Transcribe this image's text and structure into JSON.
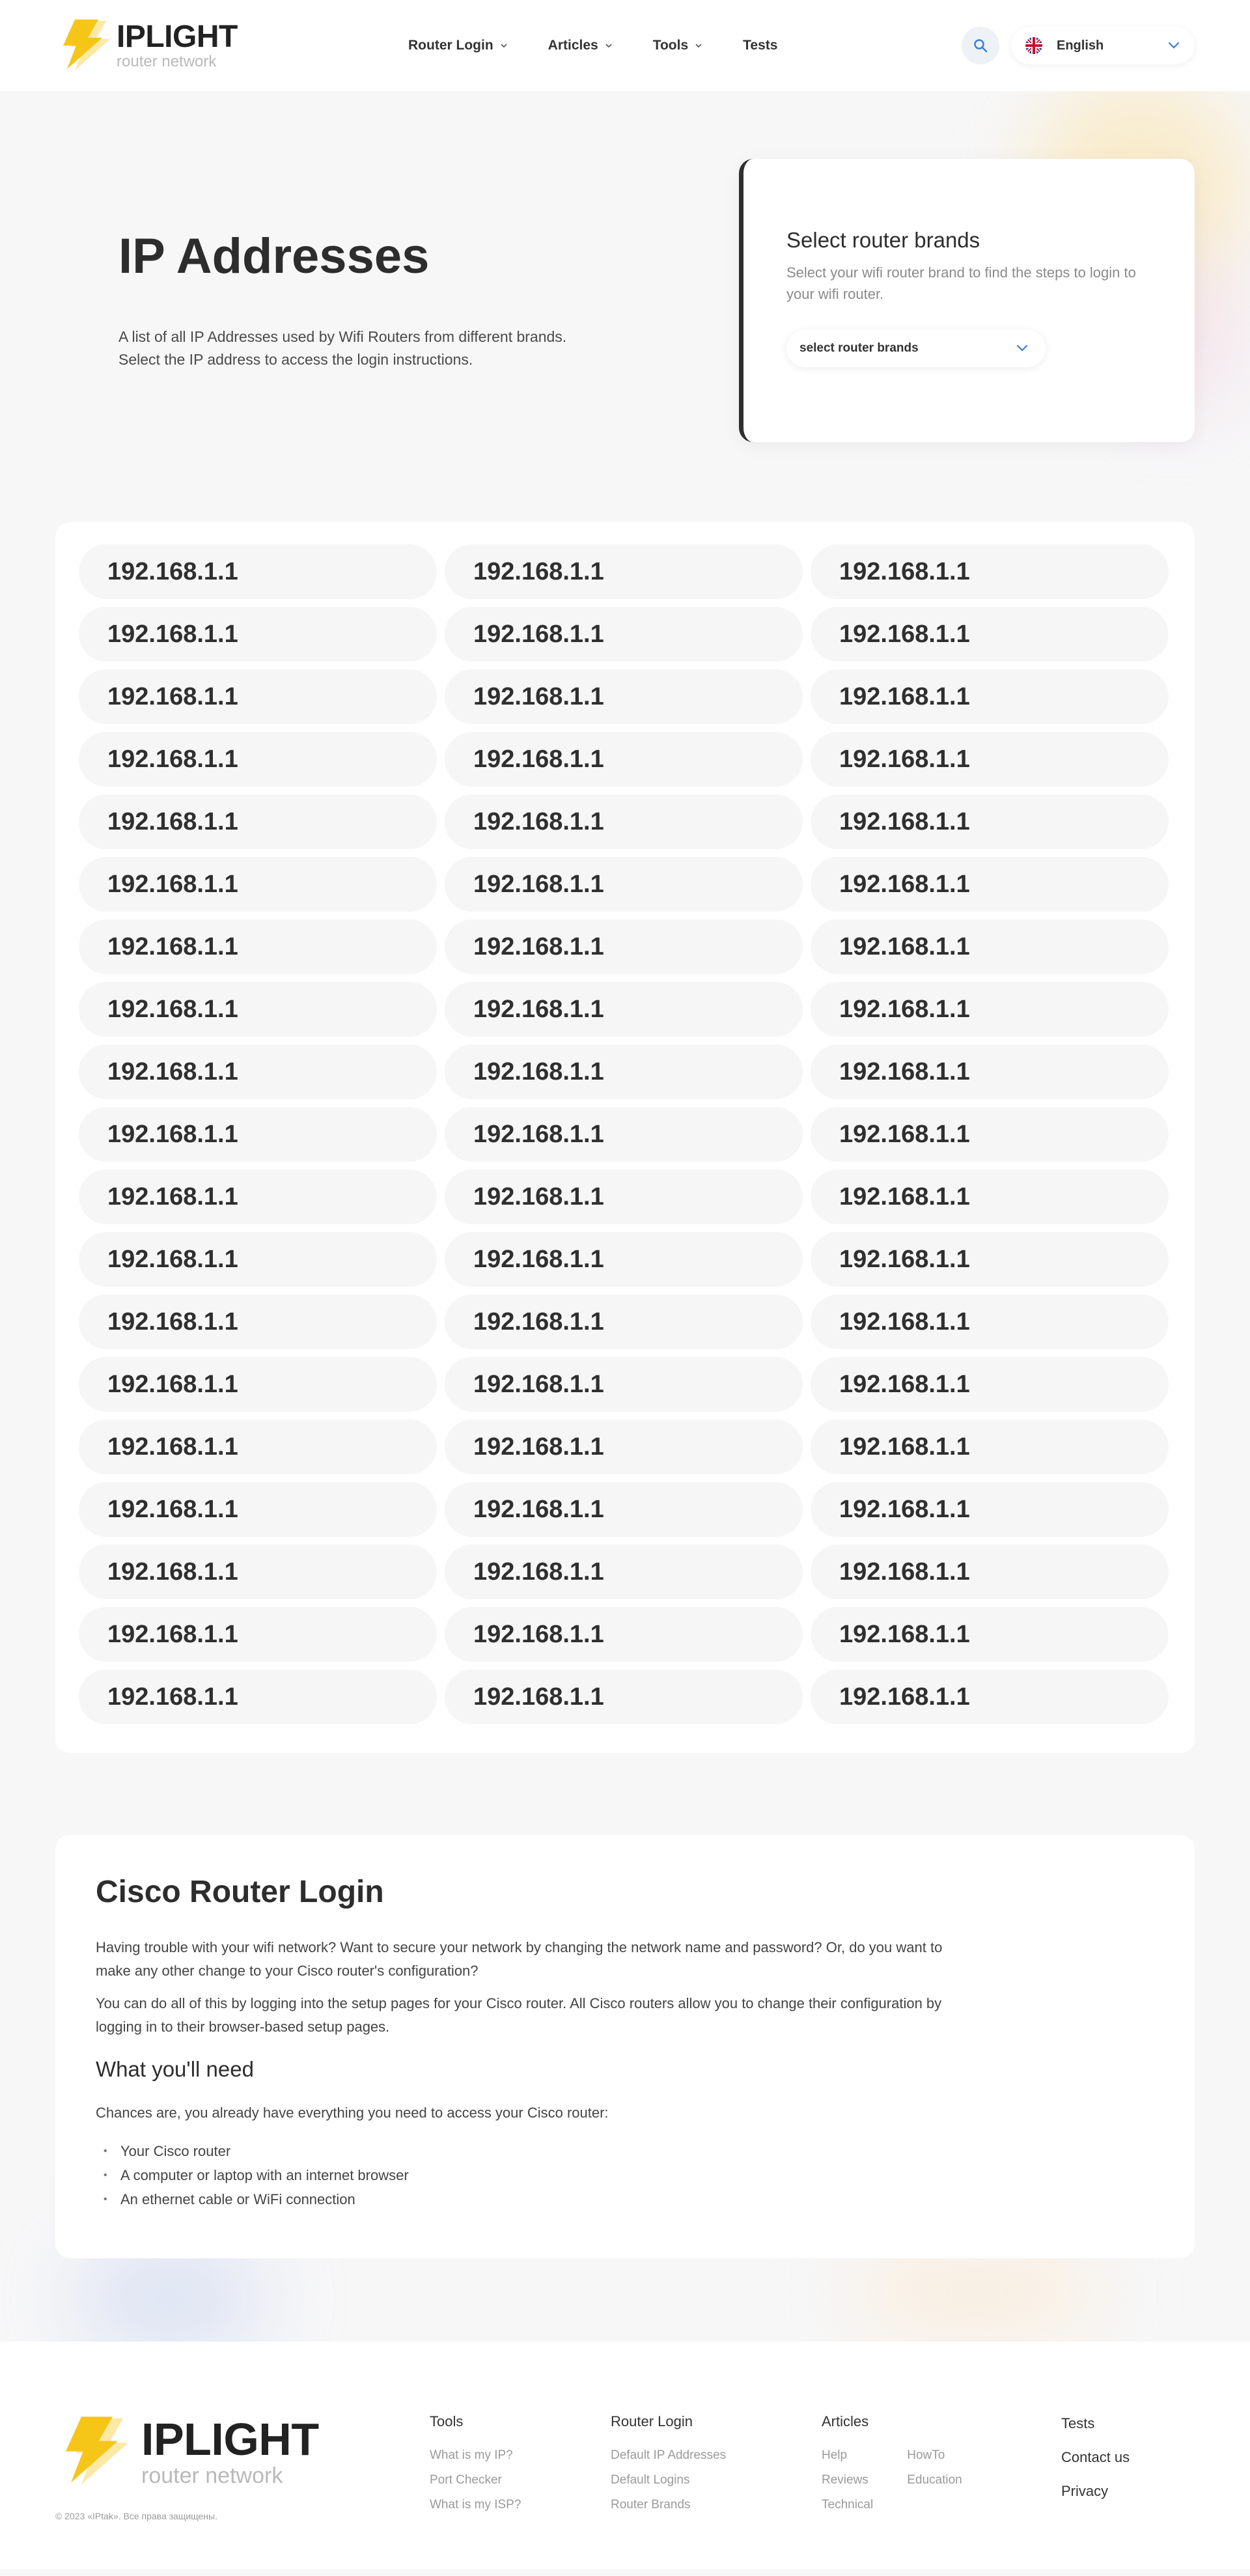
{
  "colors": {
    "accent": "#f5c518",
    "text": "#2d2d2d",
    "muted": "#9a9a9a",
    "link_blue": "#3a7bd5"
  },
  "header": {
    "logo": {
      "title": "IPLIGHT",
      "subtitle": "router network",
      "icon": "lightning-bolt-icon"
    },
    "nav": [
      {
        "label": "Router Login",
        "has_dropdown": true
      },
      {
        "label": "Articles",
        "has_dropdown": true
      },
      {
        "label": "Tools",
        "has_dropdown": true
      },
      {
        "label": "Tests",
        "has_dropdown": false
      }
    ],
    "search_icon": "search-icon",
    "language": {
      "label": "English",
      "flag": "uk-flag-icon"
    }
  },
  "hero": {
    "title": "IP Addresses",
    "description_line1": "A list of all IP Addresses used by Wifi Routers from different brands.",
    "description_line2": "Select the IP address to access the login instructions."
  },
  "brand_card": {
    "title": "Select router brands",
    "description": "Select your wifi router brand to find the steps to login to your wifi router.",
    "select_placeholder": "select router brands"
  },
  "ip_list": [
    "192.168.1.1",
    "192.168.1.1",
    "192.168.1.1",
    "192.168.1.1",
    "192.168.1.1",
    "192.168.1.1",
    "192.168.1.1",
    "192.168.1.1",
    "192.168.1.1",
    "192.168.1.1",
    "192.168.1.1",
    "192.168.1.1",
    "192.168.1.1",
    "192.168.1.1",
    "192.168.1.1",
    "192.168.1.1",
    "192.168.1.1",
    "192.168.1.1",
    "192.168.1.1",
    "192.168.1.1",
    "192.168.1.1",
    "192.168.1.1",
    "192.168.1.1",
    "192.168.1.1",
    "192.168.1.1",
    "192.168.1.1",
    "192.168.1.1",
    "192.168.1.1",
    "192.168.1.1",
    "192.168.1.1",
    "192.168.1.1",
    "192.168.1.1",
    "192.168.1.1",
    "192.168.1.1",
    "192.168.1.1",
    "192.168.1.1",
    "192.168.1.1",
    "192.168.1.1",
    "192.168.1.1",
    "192.168.1.1",
    "192.168.1.1",
    "192.168.1.1",
    "192.168.1.1",
    "192.168.1.1",
    "192.168.1.1",
    "192.168.1.1",
    "192.168.1.1",
    "192.168.1.1",
    "192.168.1.1",
    "192.168.1.1",
    "192.168.1.1",
    "192.168.1.1",
    "192.168.1.1",
    "192.168.1.1",
    "192.168.1.1",
    "192.168.1.1",
    "192.168.1.1"
  ],
  "article": {
    "title": "Cisco Router Login",
    "paragraph1": "Having trouble with your wifi network? Want to secure your network by changing the network name and password? Or, do you want to make any other change to your Cisco router's configuration?",
    "paragraph2": "You can do all of this by logging into the setup pages for your Cisco router. All Cisco routers allow you to change their configuration by logging in to their browser-based setup pages.",
    "subtitle": "What you'll need",
    "paragraph3": "Chances are, you already have everything you need to access your Cisco router:",
    "needs": [
      "Your Cisco router",
      "A computer or laptop with an internet browser",
      "An ethernet cable or WiFi connection"
    ]
  },
  "footer": {
    "logo": {
      "title": "IPLIGHT",
      "subtitle": "router network"
    },
    "copyright": "© 2023 «IPtak». Все права защищены.",
    "tools": {
      "title": "Tools",
      "links": [
        "What is my IP?",
        "Port Checker",
        "What is my ISP?"
      ]
    },
    "router_login": {
      "title": "Router Login",
      "links": [
        "Default IP Addresses",
        "Default Logins",
        "Router Brands"
      ]
    },
    "articles": {
      "title": "Articles",
      "links_col1": [
        "Help",
        "Reviews",
        "Technical"
      ],
      "links_col2": [
        "HowTo",
        "Education"
      ]
    },
    "misc": {
      "links": [
        "Tests",
        "Contact us",
        "Privacy"
      ]
    }
  }
}
